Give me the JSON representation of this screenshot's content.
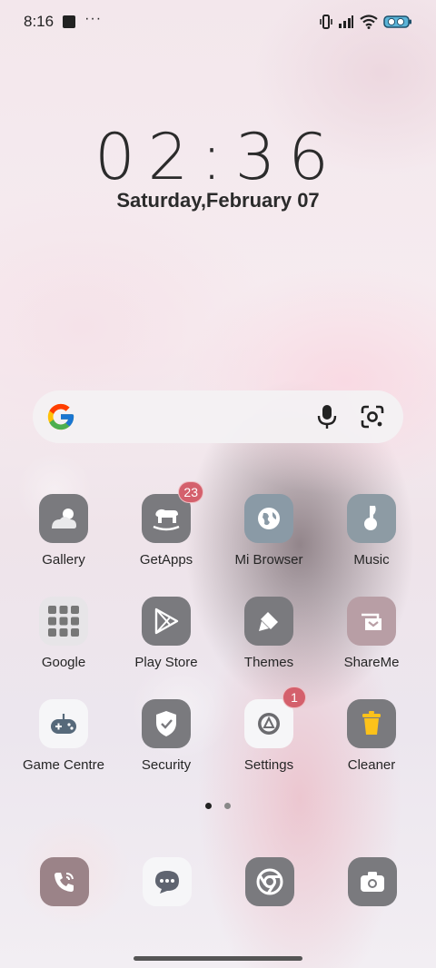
{
  "status_bar": {
    "time": "8:16",
    "overflow": "···",
    "icons": [
      "notification-square-icon",
      "vibrate-icon",
      "signal-icon",
      "wifi-icon",
      "battery-icon"
    ]
  },
  "clock": {
    "time": "02:36",
    "date": "Saturday,February 07"
  },
  "search": {
    "logo": "google-logo",
    "icons": [
      "microphone-icon",
      "lens-icon"
    ]
  },
  "apps": [
    {
      "label": "Gallery",
      "icon": "gallery-icon"
    },
    {
      "label": "GetApps",
      "icon": "getapps-icon",
      "badge": "23"
    },
    {
      "label": "Mi Browser",
      "icon": "browser-icon"
    },
    {
      "label": "Music",
      "icon": "music-icon"
    },
    {
      "label": "Google",
      "icon": "google-folder-icon"
    },
    {
      "label": "Play Store",
      "icon": "play-store-icon"
    },
    {
      "label": "Themes",
      "icon": "themes-icon"
    },
    {
      "label": "ShareMe",
      "icon": "shareme-icon"
    },
    {
      "label": "Game Centre",
      "icon": "gamepad-icon"
    },
    {
      "label": "Security",
      "icon": "shield-icon"
    },
    {
      "label": "Settings",
      "icon": "settings-icon",
      "badge": "1"
    },
    {
      "label": "Cleaner",
      "icon": "trash-icon"
    }
  ],
  "dock": [
    "phone-icon",
    "messages-icon",
    "chrome-icon",
    "camera-icon"
  ],
  "pager": {
    "pages": 2,
    "active": 0
  },
  "colors": {
    "badge": "#d4606c",
    "icon_grey": "#7a7a7e",
    "icon_white": "#f6f6f8"
  }
}
